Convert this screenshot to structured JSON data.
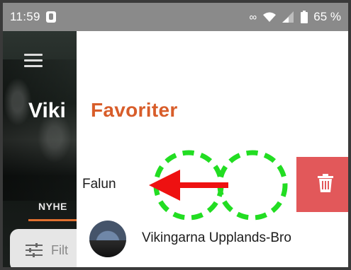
{
  "status_bar": {
    "time": "11:59",
    "battery_text": "65 %"
  },
  "background_app": {
    "title": "Viki",
    "tab_label": "NYHE",
    "filter_label": "Filt",
    "accent_color": "#e07030"
  },
  "drawer": {
    "title": "Favoriter",
    "title_color": "#d85d2a",
    "favorites": [
      {
        "label": "Falun",
        "swiped": true
      },
      {
        "label": "Vikingarna Upplands-Bro",
        "swiped": false
      }
    ],
    "delete_button": {
      "icon": "trash-icon",
      "color": "#e2585a"
    }
  },
  "gesture_hint": {
    "type": "swipe-left",
    "circle_color": "#22dd22",
    "arrow_color": "#ee1111"
  }
}
